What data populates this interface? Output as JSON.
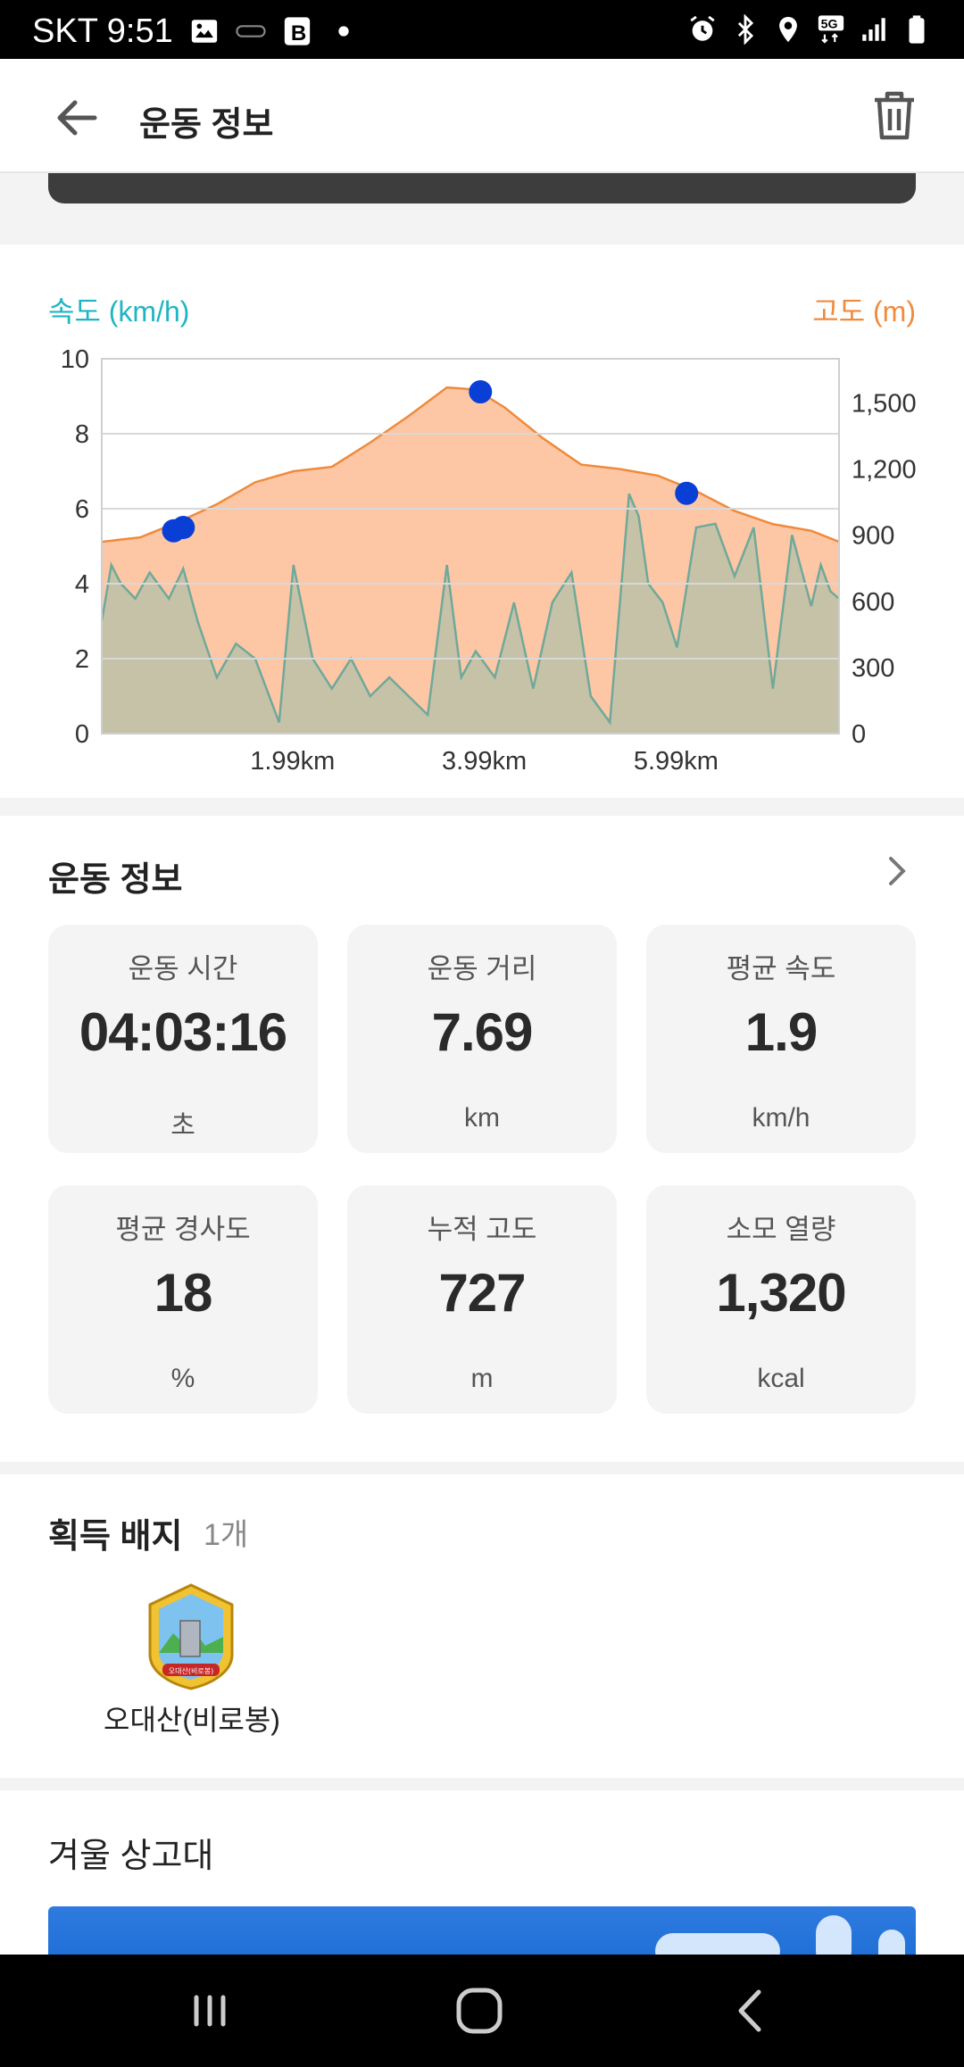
{
  "status_bar": {
    "carrier_time": "SKT 9:51",
    "network": "5G"
  },
  "header": {
    "title": "운동 정보",
    "back_icon": "arrow-left-icon",
    "delete_icon": "trash-icon"
  },
  "chart": {
    "left_axis_title": "속도 (km/h)",
    "right_axis_title": "고도 (m)",
    "colors": {
      "speed": "#1fb5c3",
      "altitude": "#f08a3c",
      "altitude_fill": "#fdc7a6",
      "speed_fill": "#c3c2a6",
      "marker": "#0a3fd6"
    }
  },
  "chart_data": {
    "type": "area",
    "xlabel": "",
    "x_tick_labels": [
      "1.99km",
      "3.99km",
      "5.99km"
    ],
    "left_axis": {
      "label": "속도 (km/h)",
      "ylim": [
        0,
        10
      ],
      "ticks": [
        0,
        2,
        4,
        6,
        8,
        10
      ]
    },
    "right_axis": {
      "label": "고도 (m)",
      "ylim": [
        0,
        1700
      ],
      "ticks": [
        "0",
        "300",
        "600",
        "900",
        "1,200",
        "1,500"
      ]
    },
    "grid": true,
    "series": [
      {
        "name": "고도 (m)",
        "axis": "right",
        "x_km": [
          0,
          0.4,
          0.8,
          1.2,
          1.6,
          2.0,
          2.4,
          2.8,
          3.2,
          3.6,
          3.9,
          4.2,
          4.6,
          5.0,
          5.4,
          5.8,
          6.2,
          6.6,
          7.0,
          7.4,
          7.69
        ],
        "values": [
          870,
          890,
          960,
          1040,
          1140,
          1190,
          1210,
          1320,
          1440,
          1570,
          1560,
          1480,
          1340,
          1220,
          1200,
          1170,
          1100,
          1010,
          950,
          920,
          870
        ]
      },
      {
        "name": "속도 (km/h)",
        "axis": "left",
        "x_km": [
          0,
          0.1,
          0.2,
          0.35,
          0.5,
          0.7,
          0.85,
          1.0,
          1.2,
          1.4,
          1.6,
          1.85,
          2.0,
          2.2,
          2.4,
          2.6,
          2.8,
          3.0,
          3.2,
          3.4,
          3.6,
          3.75,
          3.9,
          4.1,
          4.3,
          4.5,
          4.7,
          4.9,
          5.1,
          5.3,
          5.5,
          5.6,
          5.7,
          5.85,
          6.0,
          6.2,
          6.4,
          6.6,
          6.8,
          7.0,
          7.2,
          7.4,
          7.5,
          7.6,
          7.69
        ],
        "values": [
          3.0,
          4.5,
          4.0,
          3.6,
          4.3,
          3.6,
          4.4,
          3.0,
          1.5,
          2.4,
          2.0,
          0.3,
          4.5,
          2.0,
          1.2,
          2.0,
          1.0,
          1.5,
          1.0,
          0.5,
          4.5,
          1.5,
          2.2,
          1.5,
          3.5,
          1.2,
          3.5,
          4.3,
          1.0,
          0.3,
          6.4,
          5.8,
          4.0,
          3.5,
          2.3,
          5.5,
          5.6,
          4.2,
          5.5,
          1.2,
          5.3,
          3.4,
          4.5,
          3.8,
          3.6
        ]
      }
    ],
    "markers": [
      {
        "x_km": 0.75,
        "altitude": 920
      },
      {
        "x_km": 0.85,
        "altitude": 935
      },
      {
        "x_km": 3.95,
        "altitude": 1550
      },
      {
        "x_km": 6.1,
        "altitude": 1090
      }
    ]
  },
  "stats": {
    "section_title": "운동 정보",
    "items": [
      {
        "label": "운동 시간",
        "value": "04:03:16",
        "unit": "초"
      },
      {
        "label": "운동 거리",
        "value": "7.69",
        "unit": "km"
      },
      {
        "label": "평균 속도",
        "value": "1.9",
        "unit": "km/h"
      },
      {
        "label": "평균 경사도",
        "value": "18",
        "unit": "%"
      },
      {
        "label": "누적 고도",
        "value": "727",
        "unit": "m"
      },
      {
        "label": "소모 열량",
        "value": "1,320",
        "unit": "kcal"
      }
    ]
  },
  "badges": {
    "title": "획득 배지",
    "count": "1개",
    "items": [
      {
        "name": "오대산(비로봉)",
        "emblem_text": "오대산(비로봉)"
      }
    ]
  },
  "season": {
    "title": "겨울 상고대"
  },
  "nav_bar": {
    "icons": [
      "recent-apps-icon",
      "home-icon",
      "back-icon"
    ]
  }
}
